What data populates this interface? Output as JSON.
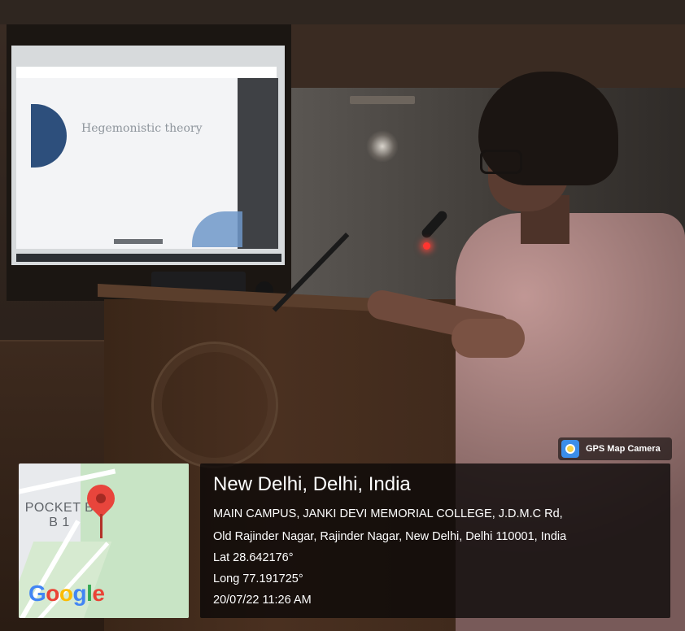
{
  "slide": {
    "title": "Hegemonistic theory"
  },
  "gps_camera": {
    "badge_label": "GPS Map Camera",
    "icon": "gps-camera-icon"
  },
  "map": {
    "label_line1": "POCKET B",
    "label_line2": "B 1",
    "logo_letters": [
      "G",
      "o",
      "o",
      "g",
      "l",
      "e"
    ],
    "logo_colors": [
      "#4285F4",
      "#EA4335",
      "#FBBC05",
      "#4285F4",
      "#34A853",
      "#EA4335"
    ],
    "pin_icon": "map-pin-icon",
    "pin_color": "#e8453c"
  },
  "location": {
    "city": "New Delhi, Delhi, India",
    "address_line1": "MAIN CAMPUS, JANKI DEVI MEMORIAL COLLEGE, J.D.M.C Rd,",
    "address_line2": "Old Rajinder Nagar, Rajinder Nagar, New Delhi, Delhi 110001, India",
    "latitude": "Lat 28.642176°",
    "longitude": "Long 77.191725°",
    "timestamp": "20/07/22 11:26 AM"
  }
}
